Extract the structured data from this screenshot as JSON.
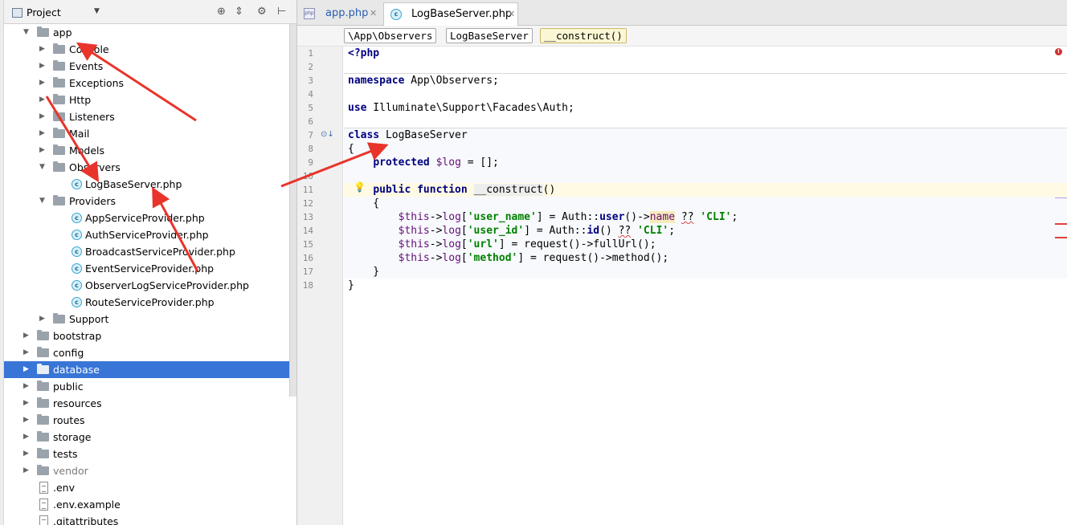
{
  "project_panel": {
    "title": "Project",
    "tree": [
      {
        "label": "app",
        "depth": 1,
        "type": "folder",
        "expanded": true
      },
      {
        "label": "Console",
        "depth": 2,
        "type": "folder"
      },
      {
        "label": "Events",
        "depth": 2,
        "type": "folder"
      },
      {
        "label": "Exceptions",
        "depth": 2,
        "type": "folder"
      },
      {
        "label": "Http",
        "depth": 2,
        "type": "folder"
      },
      {
        "label": "Listeners",
        "depth": 2,
        "type": "folder"
      },
      {
        "label": "Mail",
        "depth": 2,
        "type": "folder"
      },
      {
        "label": "Models",
        "depth": 2,
        "type": "folder"
      },
      {
        "label": "Observers",
        "depth": 2,
        "type": "folder",
        "expanded": true
      },
      {
        "label": "LogBaseServer.php",
        "depth": 3,
        "type": "class"
      },
      {
        "label": "Providers",
        "depth": 2,
        "type": "folder",
        "expanded": true
      },
      {
        "label": "AppServiceProvider.php",
        "depth": 3,
        "type": "class"
      },
      {
        "label": "AuthServiceProvider.php",
        "depth": 3,
        "type": "class"
      },
      {
        "label": "BroadcastServiceProvider.php",
        "depth": 3,
        "type": "class"
      },
      {
        "label": "EventServiceProvider.php",
        "depth": 3,
        "type": "class"
      },
      {
        "label": "ObserverLogServiceProvider.php",
        "depth": 3,
        "type": "class"
      },
      {
        "label": "RouteServiceProvider.php",
        "depth": 3,
        "type": "class"
      },
      {
        "label": "Support",
        "depth": 2,
        "type": "folder"
      },
      {
        "label": "bootstrap",
        "depth": 1,
        "type": "folder"
      },
      {
        "label": "config",
        "depth": 1,
        "type": "folder"
      },
      {
        "label": "database",
        "depth": 1,
        "type": "folder",
        "selected": true
      },
      {
        "label": "public",
        "depth": 1,
        "type": "folder"
      },
      {
        "label": "resources",
        "depth": 1,
        "type": "folder"
      },
      {
        "label": "routes",
        "depth": 1,
        "type": "folder"
      },
      {
        "label": "storage",
        "depth": 1,
        "type": "folder"
      },
      {
        "label": "tests",
        "depth": 1,
        "type": "folder"
      },
      {
        "label": "vendor",
        "depth": 1,
        "type": "folder",
        "dim": true
      },
      {
        "label": ".env",
        "depth": 1,
        "type": "file"
      },
      {
        "label": ".env.example",
        "depth": 1,
        "type": "file"
      },
      {
        "label": ".gitattributes",
        "depth": 1,
        "type": "file"
      }
    ]
  },
  "editor": {
    "tabs": [
      {
        "label": "app.php",
        "icon": "php-file-icon",
        "active": false
      },
      {
        "label": "LogBaseServer.php",
        "icon": "class-icon",
        "active": true
      }
    ],
    "breadcrumbs": [
      "\\App\\Observers",
      "LogBaseServer",
      "__construct()"
    ],
    "line_numbers": [
      "1",
      "2",
      "3",
      "4",
      "5",
      "6",
      "7",
      "8",
      "9",
      "10",
      "11",
      "12",
      "13",
      "14",
      "15",
      "16",
      "17",
      "18"
    ]
  },
  "colors": {
    "selection": "#3875d7",
    "annotation_arrow": "#e8342b",
    "keyword": "#000080",
    "string": "#008000",
    "variable": "#660e7a"
  }
}
